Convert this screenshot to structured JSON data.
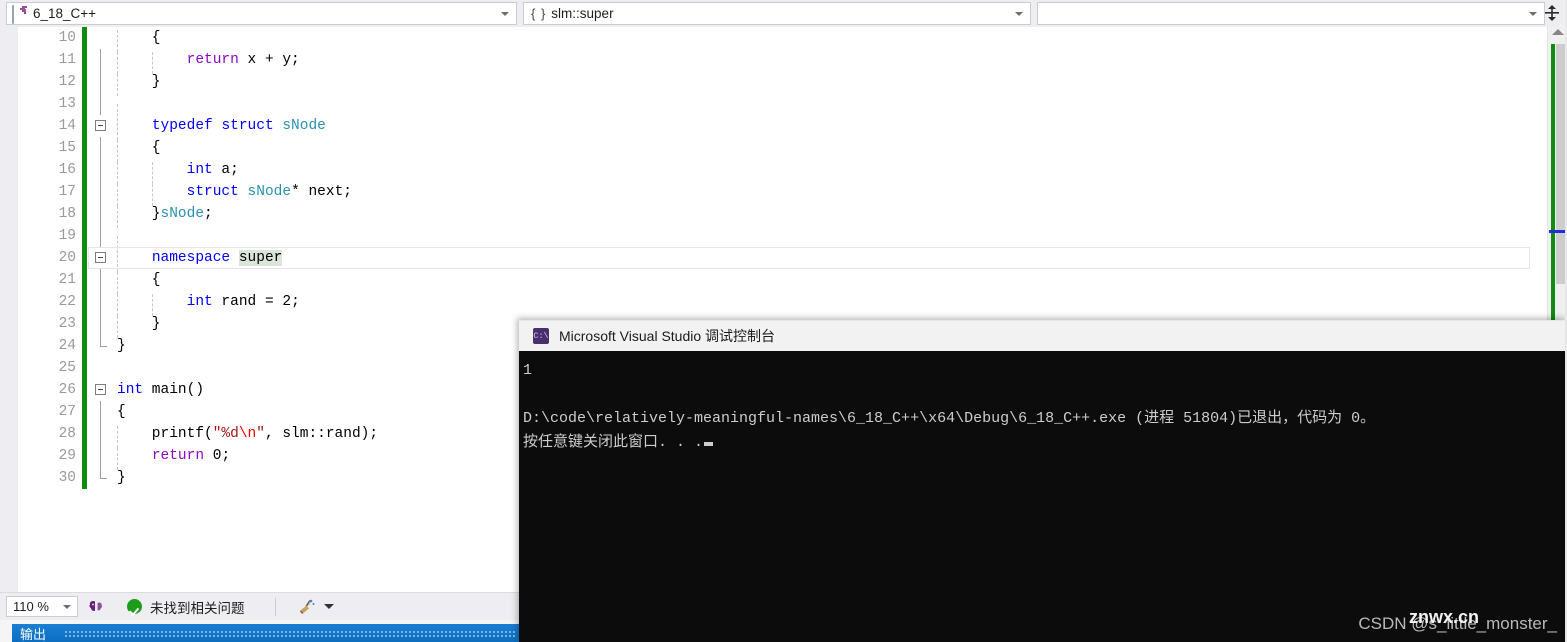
{
  "navbar": {
    "project_combo": {
      "icon": "cpp-project-icon",
      "value": "6_18_C++",
      "arrow": "chevron-down-icon"
    },
    "scope_combo": {
      "icon": "namespace-braces-icon",
      "brace": "{ }",
      "value": "slm::super",
      "arrow": "chevron-down-icon"
    },
    "member_combo": {
      "value": "",
      "arrow": "chevron-down-icon"
    },
    "split_button": "split-view-icon"
  },
  "editor": {
    "lines": [
      {
        "n": "10",
        "indent": 1,
        "code": [
          {
            "t": "    {",
            "c": "plain"
          }
        ]
      },
      {
        "n": "11",
        "indent": 2,
        "code": [
          {
            "t": "        ",
            "c": "plain"
          },
          {
            "t": "return",
            "c": "ctrl"
          },
          {
            "t": " x + y;",
            "c": "plain"
          }
        ]
      },
      {
        "n": "12",
        "indent": 1,
        "code": [
          {
            "t": "    }",
            "c": "plain"
          }
        ]
      },
      {
        "n": "13",
        "indent": 1,
        "code": [
          {
            "t": "",
            "c": "plain"
          }
        ]
      },
      {
        "n": "14",
        "indent": 1,
        "code": [
          {
            "t": "    ",
            "c": "plain"
          },
          {
            "t": "typedef",
            "c": "kw"
          },
          {
            "t": " ",
            "c": "plain"
          },
          {
            "t": "struct",
            "c": "kw"
          },
          {
            "t": " ",
            "c": "plain"
          },
          {
            "t": "sNode",
            "c": "type"
          }
        ]
      },
      {
        "n": "15",
        "indent": 1,
        "code": [
          {
            "t": "    {",
            "c": "plain"
          }
        ]
      },
      {
        "n": "16",
        "indent": 2,
        "code": [
          {
            "t": "        ",
            "c": "plain"
          },
          {
            "t": "int",
            "c": "kw"
          },
          {
            "t": " a;",
            "c": "plain"
          }
        ]
      },
      {
        "n": "17",
        "indent": 2,
        "code": [
          {
            "t": "        ",
            "c": "plain"
          },
          {
            "t": "struct",
            "c": "kw"
          },
          {
            "t": " ",
            "c": "plain"
          },
          {
            "t": "sNode",
            "c": "type"
          },
          {
            "t": "* next;",
            "c": "plain"
          }
        ]
      },
      {
        "n": "18",
        "indent": 1,
        "code": [
          {
            "t": "    }",
            "c": "plain"
          },
          {
            "t": "sNode",
            "c": "type"
          },
          {
            "t": ";",
            "c": "plain"
          }
        ]
      },
      {
        "n": "19",
        "indent": 1,
        "code": [
          {
            "t": "",
            "c": "plain"
          }
        ]
      },
      {
        "n": "20",
        "indent": 1,
        "code": [
          {
            "t": "    ",
            "c": "plain"
          },
          {
            "t": "namespace",
            "c": "kw"
          },
          {
            "t": " ",
            "c": "plain"
          },
          {
            "t": "super",
            "c": "plain hl-ref"
          }
        ]
      },
      {
        "n": "21",
        "indent": 1,
        "code": [
          {
            "t": "    {",
            "c": "plain"
          }
        ]
      },
      {
        "n": "22",
        "indent": 2,
        "code": [
          {
            "t": "        ",
            "c": "plain"
          },
          {
            "t": "int",
            "c": "kw"
          },
          {
            "t": " rand = ",
            "c": "plain"
          },
          {
            "t": "2",
            "c": "num"
          },
          {
            "t": ";",
            "c": "plain"
          }
        ]
      },
      {
        "n": "23",
        "indent": 1,
        "code": [
          {
            "t": "    }",
            "c": "plain"
          }
        ]
      },
      {
        "n": "24",
        "indent": 0,
        "code": [
          {
            "t": "}",
            "c": "plain"
          }
        ]
      },
      {
        "n": "25",
        "indent": 0,
        "code": [
          {
            "t": "",
            "c": "plain"
          }
        ]
      },
      {
        "n": "26",
        "indent": 0,
        "code": [
          {
            "t": "int",
            "c": "kw"
          },
          {
            "t": " main()",
            "c": "plain"
          }
        ]
      },
      {
        "n": "27",
        "indent": 0,
        "code": [
          {
            "t": "{",
            "c": "plain"
          }
        ]
      },
      {
        "n": "28",
        "indent": 1,
        "code": [
          {
            "t": "    printf(",
            "c": "plain"
          },
          {
            "t": "\"%d",
            "c": "str"
          },
          {
            "t": "\\n",
            "c": "esc"
          },
          {
            "t": "\"",
            "c": "str"
          },
          {
            "t": ", slm::rand);",
            "c": "plain"
          }
        ]
      },
      {
        "n": "29",
        "indent": 1,
        "code": [
          {
            "t": "    ",
            "c": "plain"
          },
          {
            "t": "return",
            "c": "ctrl"
          },
          {
            "t": " ",
            "c": "plain"
          },
          {
            "t": "0",
            "c": "num"
          },
          {
            "t": ";",
            "c": "plain"
          }
        ]
      },
      {
        "n": "30",
        "indent": 0,
        "code": [
          {
            "t": "}",
            "c": "plain"
          }
        ]
      }
    ],
    "current_line": "20",
    "fold_markers": [
      "14",
      "20",
      "26"
    ],
    "change_bar_color": "#108c10"
  },
  "scrollbar": {
    "up_arrow": "scroll-up-arrow-icon",
    "caret_marker_color": "#1f2fd8",
    "change_marker_color": "#108c10"
  },
  "statusbar": {
    "zoom_value": "110 %",
    "zoom_arrow": "chevron-down-icon",
    "intellicode_icon": "intellicode-brain-icon",
    "status_icon": "green-check-icon",
    "status_text": "未找到相关问题",
    "cleanup_icon": "code-cleanup-broom-icon",
    "cleanup_arrow": "chevron-down-icon"
  },
  "output_panel": {
    "tab_label": "输出"
  },
  "console": {
    "icon": "cmd-console-icon",
    "icon_text": "C:\\",
    "title": "Microsoft Visual Studio 调试控制台",
    "lines": [
      "1",
      "",
      "D:\\code\\relatively-meaningful-names\\6_18_C++\\x64\\Debug\\6_18_C++.exe (进程 51804)已退出，代码为 0。",
      "按任意键关闭此窗口. . ."
    ],
    "cursor": "block-cursor"
  },
  "watermarks": {
    "csdn": "CSDN @s_little_monster_",
    "site": "znwx.cn"
  }
}
